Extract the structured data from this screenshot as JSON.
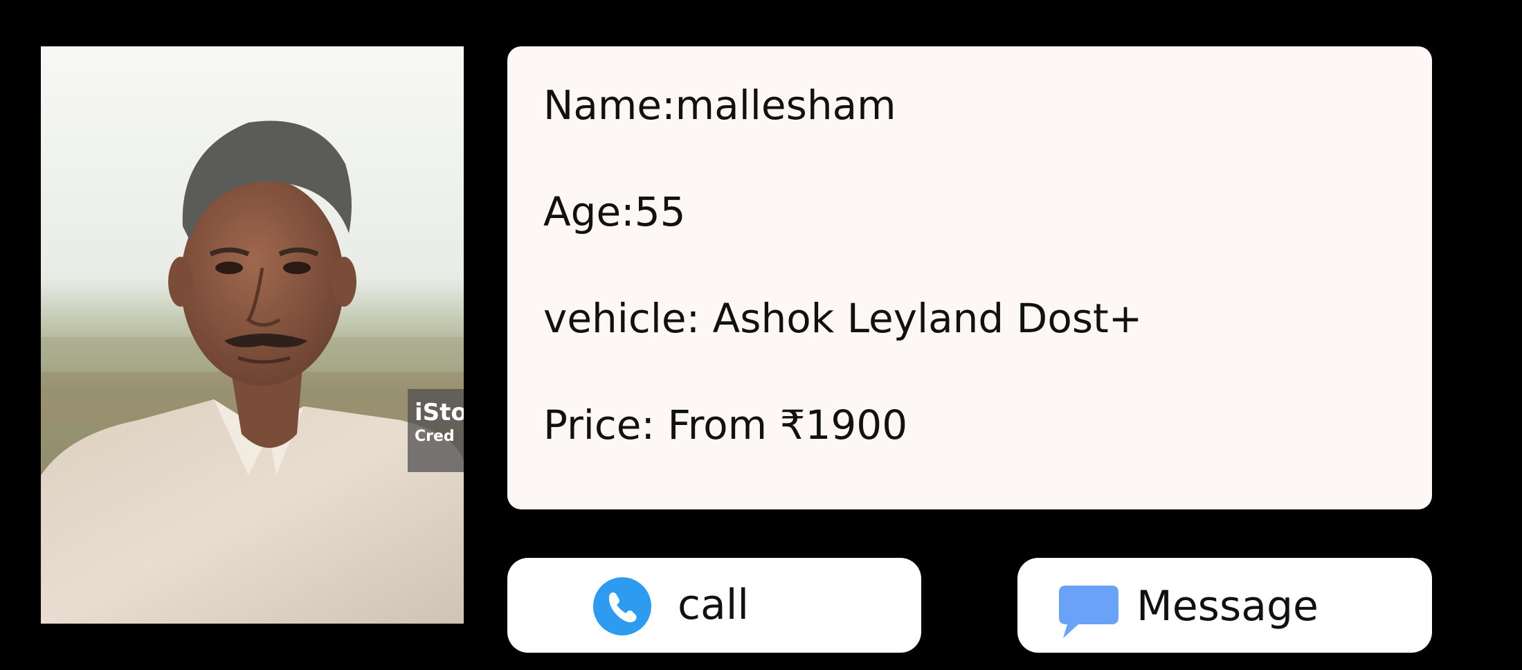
{
  "profile": {
    "photo_alt": "driver-photo",
    "watermark": {
      "brand": "iSto",
      "credit": "Cred"
    }
  },
  "info": {
    "name": "Name:mallesham",
    "age": "Age:55",
    "vehicle": "vehicle: Ashok Leyland Dost+",
    "price": "Price: From ₹1900"
  },
  "actions": {
    "call_label": "call",
    "call_icon": "phone-icon",
    "message_label": "Message",
    "message_icon": "chat-bubble-icon"
  },
  "colors": {
    "background": "#000000",
    "card": "#fdf7f6",
    "button": "#ffffff",
    "call_icon": "#2d9cf0",
    "message_icon": "#6aa2f8"
  }
}
